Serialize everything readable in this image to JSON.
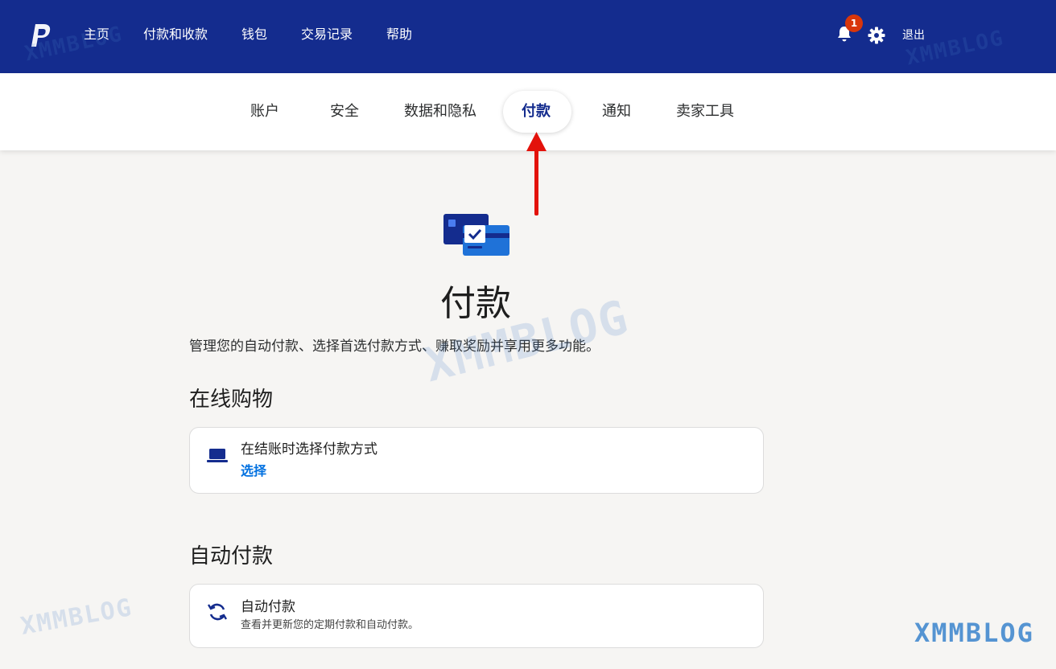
{
  "topnav": {
    "links": [
      "主页",
      "付款和收款",
      "钱包",
      "交易记录",
      "帮助"
    ],
    "notification_count": "1",
    "logout": "退出"
  },
  "subnav": {
    "tabs": [
      "账户",
      "安全",
      "数据和隐私",
      "付款",
      "通知",
      "卖家工具"
    ],
    "active_tab": "付款"
  },
  "page": {
    "title": "付款",
    "description": "管理您的自动付款、选择首选付款方式、赚取奖励并享用更多功能。"
  },
  "online_shopping": {
    "heading": "在线购物",
    "card_title": "在结账时选择付款方式",
    "card_link": "选择"
  },
  "auto_payments": {
    "heading": "自动付款",
    "card_title": "自动付款",
    "card_subtitle": "查看并更新您的定期付款和自动付款。"
  },
  "watermark": "XMMBLOG",
  "colors": {
    "header_bg": "#142c8e",
    "link_blue": "#0070e0",
    "badge_red": "#d9360b",
    "arrow_red": "#e3120b"
  }
}
